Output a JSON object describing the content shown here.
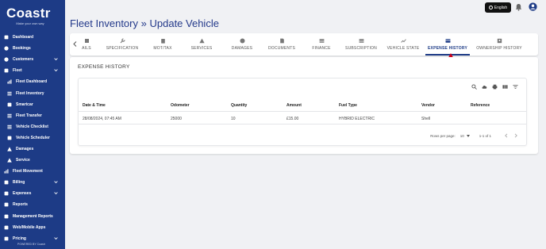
{
  "app": {
    "brand": "Coastr",
    "tagline": "Make your own way"
  },
  "sidebar": {
    "items": [
      {
        "label": "Dashboard",
        "icon": "dashboard-icon",
        "sub": false,
        "chevron": false
      },
      {
        "label": "Bookings",
        "icon": "bookings-icon",
        "sub": false,
        "chevron": false
      },
      {
        "label": "Customers",
        "icon": "customers-icon",
        "sub": false,
        "chevron": true
      },
      {
        "label": "Fleet",
        "icon": "car-icon",
        "sub": false,
        "chevron": true
      },
      {
        "label": "Fleet Dashboard",
        "icon": "fleet-dashboard-icon",
        "sub": true,
        "chevron": false
      },
      {
        "label": "Fleet Inventory",
        "icon": "fleet-inventory-icon",
        "sub": true,
        "chevron": false
      },
      {
        "label": "Smartcar",
        "icon": "smartcar-icon",
        "sub": true,
        "chevron": false
      },
      {
        "label": "Fleet Transfer",
        "icon": "transfer-icon",
        "sub": true,
        "chevron": false
      },
      {
        "label": "Vehicle Checklist",
        "icon": "checklist-icon",
        "sub": true,
        "chevron": false
      },
      {
        "label": "Vehicle Scheduler",
        "icon": "scheduler-icon",
        "sub": true,
        "chevron": false
      },
      {
        "label": "Damages",
        "icon": "warning-icon",
        "sub": true,
        "chevron": false
      },
      {
        "label": "Service",
        "icon": "wrench-icon",
        "sub": true,
        "chevron": false
      },
      {
        "label": "Fleet Movement",
        "icon": "movement-icon",
        "sub": false,
        "chevron": false
      },
      {
        "label": "Billing",
        "icon": "billing-icon",
        "sub": false,
        "chevron": true
      },
      {
        "label": "Expenses",
        "icon": "expenses-icon",
        "sub": false,
        "chevron": true
      },
      {
        "label": "Reports",
        "icon": "reports-icon",
        "sub": false,
        "chevron": false
      },
      {
        "label": "Management Reports",
        "icon": "management-reports-icon",
        "sub": false,
        "chevron": false
      },
      {
        "label": "Web/Mobile Apps",
        "icon": "apps-icon",
        "sub": false,
        "chevron": false
      },
      {
        "label": "Pricing",
        "icon": "pricing-icon",
        "sub": false,
        "chevron": true
      }
    ],
    "powered_by": "POWERED BY Coastr"
  },
  "header": {
    "breadcrumb_root": "Fleet Inventory",
    "separator": "»",
    "page_title": "Update Vehicle",
    "language": "English"
  },
  "tabs": [
    {
      "label": "AILS",
      "icon": "details-icon"
    },
    {
      "label": "SPECIFICATION",
      "icon": "wrench-icon"
    },
    {
      "label": "MOT/TAX",
      "icon": "clipboard-icon"
    },
    {
      "label": "SERVICES",
      "icon": "warning-icon"
    },
    {
      "label": "DAMAGES",
      "icon": "info-icon"
    },
    {
      "label": "DOCUMENTS",
      "icon": "document-icon"
    },
    {
      "label": "FINANCE",
      "icon": "table-icon"
    },
    {
      "label": "SUBSCRIPTION",
      "icon": "table-icon"
    },
    {
      "label": "VEHICLE STATE",
      "icon": "state-icon"
    },
    {
      "label": "EXPENSE HISTORY",
      "icon": "card-icon"
    },
    {
      "label": "OWNERSHIP HISTORY",
      "icon": "ownership-icon"
    }
  ],
  "active_tab": "EXPENSE HISTORY",
  "main": {
    "section_title": "EXPENSE HISTORY",
    "columns": [
      "Date & Time",
      "Odometer",
      "Quantity",
      "Amount",
      "Fuel Type",
      "Vendor",
      "Reference"
    ],
    "rows": [
      [
        "28/08/2024, 07:45 AM",
        "25000",
        "10",
        "£15.00",
        "HYBRID ELECTRIC",
        "Shell",
        ""
      ]
    ],
    "pagination": {
      "rows_per_page_label": "Rows per page:",
      "rows_per_page": "10",
      "range": "1-1 of 1"
    }
  },
  "colors": {
    "sidebar_bg": "#1d3b86",
    "accent": "#1d3b86",
    "annotation_arrow": "#d0021b"
  }
}
